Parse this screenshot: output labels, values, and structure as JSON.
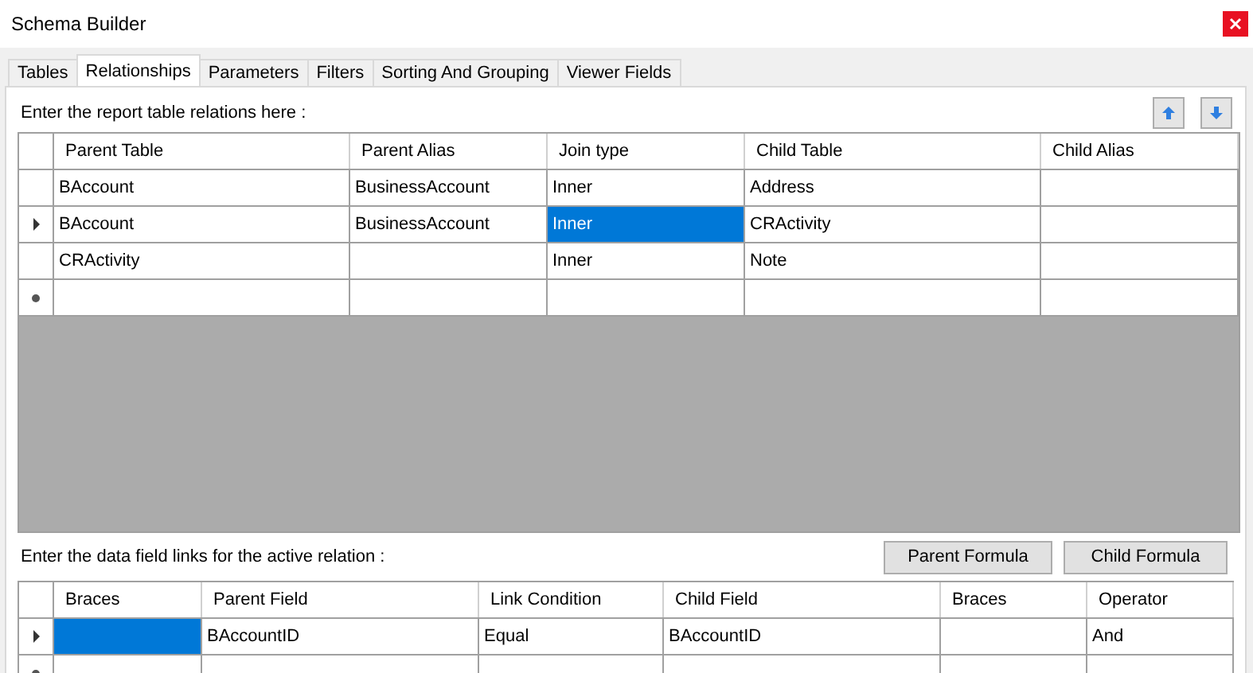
{
  "window": {
    "title": "Schema Builder"
  },
  "tabs": [
    {
      "label": "Tables",
      "selected": false
    },
    {
      "label": "Relationships",
      "selected": true
    },
    {
      "label": "Parameters",
      "selected": false
    },
    {
      "label": "Filters",
      "selected": false
    },
    {
      "label": "Sorting And Grouping",
      "selected": false
    },
    {
      "label": "Viewer Fields",
      "selected": false
    }
  ],
  "relations": {
    "label": "Enter the report table relations here :",
    "columns": [
      "Parent Table",
      "Parent Alias",
      "Join type",
      "Child Table",
      "Child Alias"
    ],
    "rows": [
      {
        "kind": "data",
        "current": false,
        "cells": [
          {
            "text": "BAccount",
            "selected": false
          },
          {
            "text": "BusinessAccount",
            "selected": false
          },
          {
            "text": "Inner",
            "selected": false
          },
          {
            "text": "Address",
            "selected": false
          },
          {
            "selected": false
          }
        ]
      },
      {
        "kind": "data",
        "current": true,
        "cells": [
          {
            "text": "BAccount",
            "selected": false
          },
          {
            "text": "BusinessAccount",
            "selected": false
          },
          {
            "text": "Inner",
            "selected": true
          },
          {
            "text": "CRActivity",
            "selected": false
          },
          {
            "selected": false
          }
        ]
      },
      {
        "kind": "data",
        "current": false,
        "cells": [
          {
            "text": "CRActivity",
            "selected": false
          },
          {
            "selected": false
          },
          {
            "text": "Inner",
            "selected": false
          },
          {
            "text": "Note",
            "selected": false
          },
          {
            "selected": false
          }
        ]
      },
      {
        "kind": "new",
        "current": false
      }
    ]
  },
  "links": {
    "label": "Enter the data field links for the active relation :",
    "buttons": [
      "Parent Formula",
      "Child Formula"
    ],
    "columns": [
      "Braces",
      "Parent Field",
      "Link Condition",
      "Child Field",
      "Braces",
      "Operator"
    ],
    "rows": [
      {
        "kind": "data",
        "current": true,
        "cells": [
          {
            "selected": true
          },
          {
            "text": "BAccountID",
            "selected": false
          },
          {
            "text": "Equal",
            "selected": false
          },
          {
            "text": "BAccountID",
            "selected": false
          },
          {
            "selected": false
          },
          {
            "text": "And",
            "selected": false
          }
        ]
      },
      {
        "kind": "new",
        "current": false
      }
    ]
  }
}
